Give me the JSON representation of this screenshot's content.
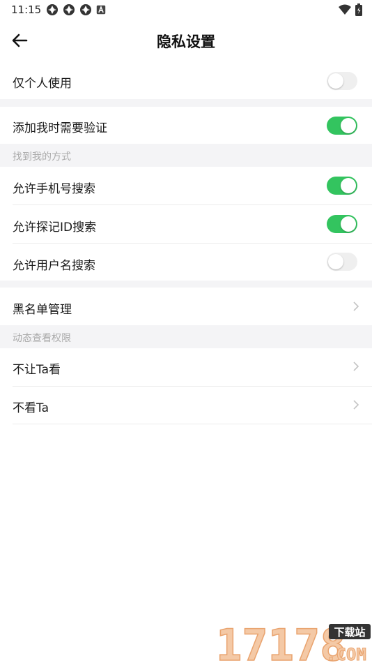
{
  "status_bar": {
    "time": "11:15"
  },
  "header": {
    "title": "隐私设置"
  },
  "rows": {
    "self_only": {
      "label": "仅个人使用",
      "toggle_on": false
    },
    "verify_add": {
      "label": "添加我时需要验证",
      "toggle_on": true
    }
  },
  "find_me": {
    "section_title": "找到我的方式",
    "phone_search": {
      "label": "允许手机号搜索",
      "toggle_on": true
    },
    "id_search": {
      "label": "允许探记ID搜索",
      "toggle_on": true
    },
    "username_search": {
      "label": "允许用户名搜索",
      "toggle_on": false
    }
  },
  "blacklist": {
    "label": "黑名单管理"
  },
  "moments": {
    "section_title": "动态查看权限",
    "hide_from": {
      "label": "不让Ta看"
    },
    "dont_see": {
      "label": "不看Ta"
    }
  },
  "watermark": {
    "number": "17178",
    "tag": "下载站",
    "domain": ".COM"
  },
  "colors": {
    "toggle_on": "#33c45f",
    "toggle_off": "#efefef",
    "section_bg": "#f4f4f6"
  },
  "icons": [
    "back-arrow-icon",
    "chevron-right-icon",
    "wifi-icon",
    "battery-icon",
    "notification-icon"
  ]
}
